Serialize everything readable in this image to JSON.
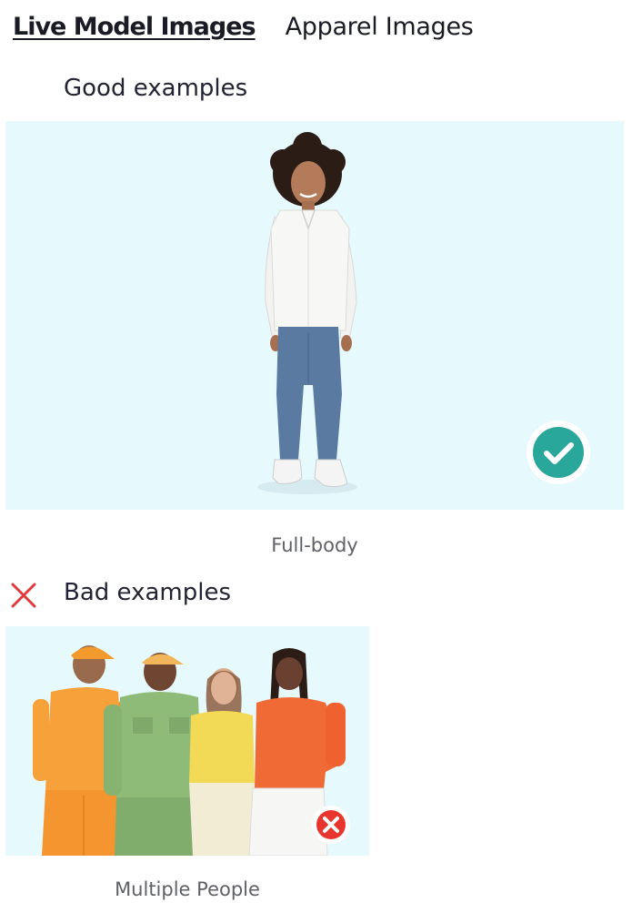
{
  "tabs": [
    {
      "label": "Live Model Images",
      "active": true
    },
    {
      "label": "Apparel Images",
      "active": false
    }
  ],
  "good_section": {
    "heading": "Good examples",
    "caption": "Full-body",
    "status_icon": "check-circle-icon",
    "status_color": "#2aa79b"
  },
  "bad_section": {
    "heading": "Bad examples",
    "heading_icon": "close-icon",
    "heading_icon_color": "#e0393e",
    "caption": "Multiple People",
    "status_icon": "x-circle-icon",
    "status_color": "#e8362f"
  },
  "colors": {
    "image_background": "#e6f9fd",
    "text": "#1f2230",
    "caption": "#5f6068"
  }
}
